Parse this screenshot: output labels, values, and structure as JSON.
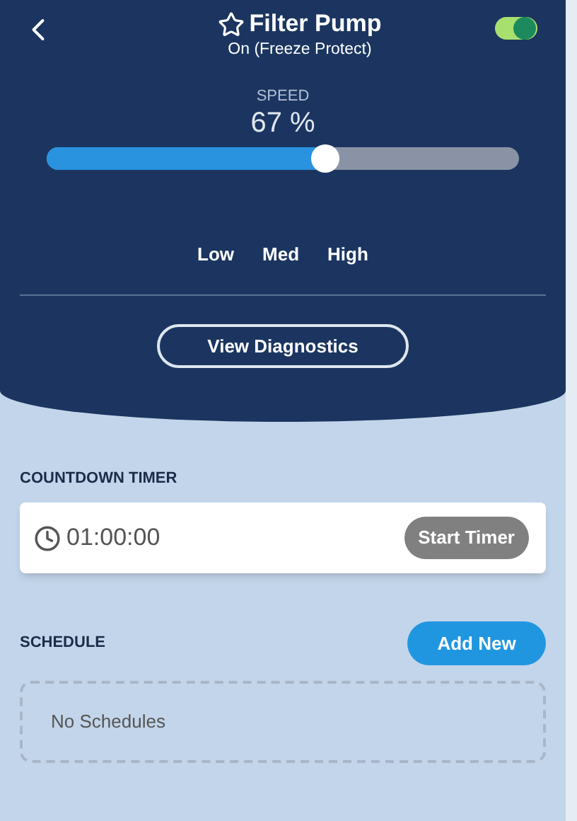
{
  "header": {
    "title": "Filter Pump",
    "favorite": false,
    "status": "On (Freeze Protect)",
    "power_on": true
  },
  "speed": {
    "label": "SPEED",
    "reading": "67 %",
    "level": 0.59,
    "presets": [
      "Low",
      "Med",
      "High"
    ]
  },
  "diagnostics_button": "View Diagnostics",
  "countdown_timer": {
    "label": "COUNTDOWN TIMER",
    "time": "01:00:00",
    "button": "Start Timer"
  },
  "schedule": {
    "label": "SCHEDULE",
    "button": "Add New",
    "empty_text": "No Schedules"
  }
}
